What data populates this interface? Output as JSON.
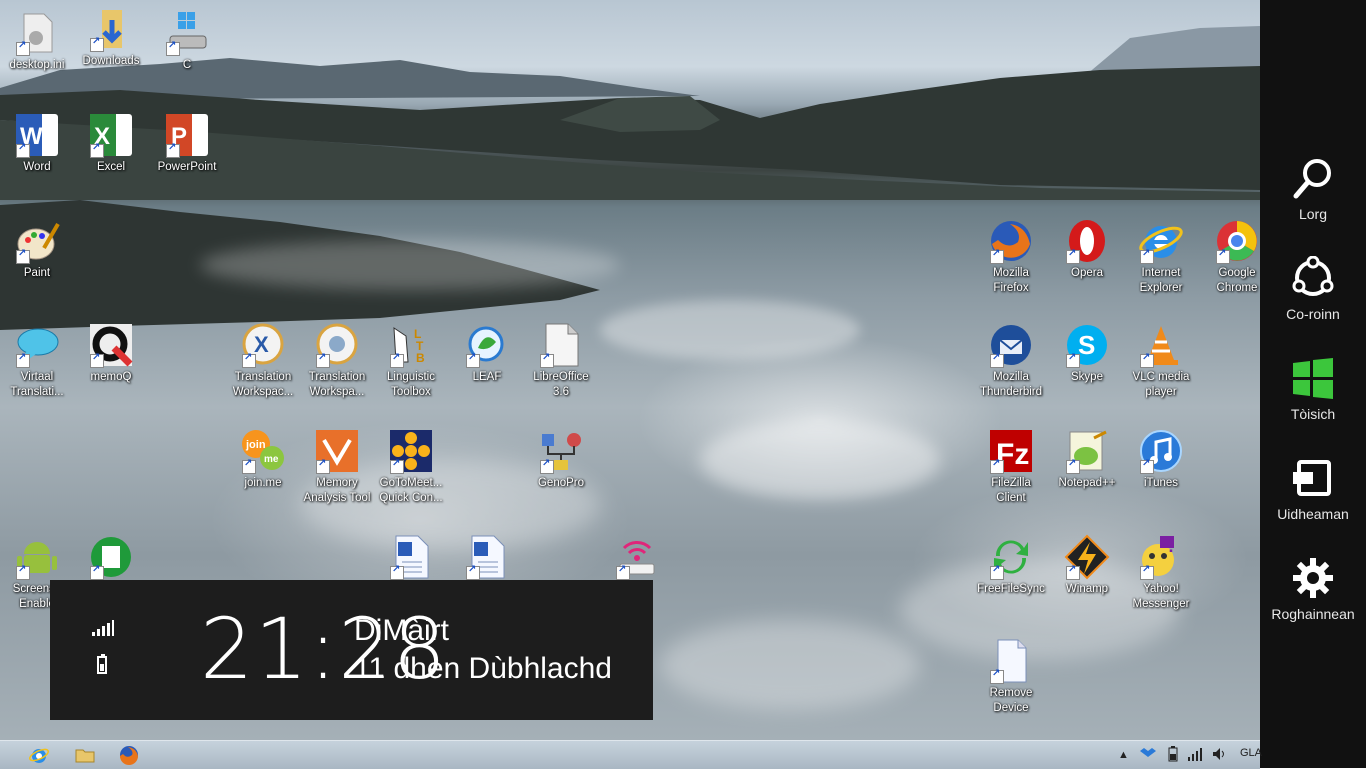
{
  "desktop": {
    "icons": [
      {
        "label": "desktop.ini",
        "icon": "settings-file-icon"
      },
      {
        "label": "Downloads",
        "icon": "download-folder-icon"
      },
      {
        "label": "C",
        "icon": "drive-icon"
      },
      {
        "label": "Word",
        "icon": "word-icon"
      },
      {
        "label": "Excel",
        "icon": "excel-icon"
      },
      {
        "label": "PowerPoint",
        "icon": "powerpoint-icon"
      },
      {
        "label": "Paint",
        "icon": "paint-icon"
      },
      {
        "label": "Virtaal\nTranslati...",
        "icon": "virtaal-icon"
      },
      {
        "label": "memoQ",
        "icon": "memoq-icon"
      },
      {
        "label": "Translation\nWorkspac...",
        "icon": "translation-workspace-icon"
      },
      {
        "label": "Translation\nWorkspa...",
        "icon": "translation-workspace-2-icon"
      },
      {
        "label": "Linguistic\nToolbox",
        "icon": "linguistic-toolbox-icon"
      },
      {
        "label": "LEAF",
        "icon": "leaf-icon"
      },
      {
        "label": "LibreOffice\n3.6",
        "icon": "libreoffice-icon"
      },
      {
        "label": "join.me",
        "icon": "joinme-icon"
      },
      {
        "label": "Memory\nAnalysis Tool",
        "icon": "memory-analysis-icon"
      },
      {
        "label": "GoToMeet...\nQuick Con...",
        "icon": "gotomeeting-icon"
      },
      {
        "label": "GenoPro",
        "icon": "genopro-icon"
      },
      {
        "label": "Screensh\nEnable",
        "icon": "android-icon"
      },
      {
        "label": "",
        "icon": "green-app-icon"
      },
      {
        "label": "",
        "icon": "word-doc-icon"
      },
      {
        "label": "",
        "icon": "word-doc-2-icon"
      },
      {
        "label": "",
        "icon": "wifi-device-icon"
      },
      {
        "label": "Mozilla\nFirefox",
        "icon": "firefox-icon"
      },
      {
        "label": "Opera",
        "icon": "opera-icon"
      },
      {
        "label": "Internet\nExplorer",
        "icon": "ie-icon"
      },
      {
        "label": "Google\nChrome",
        "icon": "chrome-icon"
      },
      {
        "label": "Mozilla\nThunderbird",
        "icon": "thunderbird-icon"
      },
      {
        "label": "Skype",
        "icon": "skype-icon"
      },
      {
        "label": "VLC media\nplayer",
        "icon": "vlc-icon"
      },
      {
        "label": "FileZilla\nClient",
        "icon": "filezilla-icon"
      },
      {
        "label": "Notepad++",
        "icon": "notepadpp-icon"
      },
      {
        "label": "iTunes",
        "icon": "itunes-icon"
      },
      {
        "label": "FreeFileSync",
        "icon": "freefilesync-icon"
      },
      {
        "label": "Winamp",
        "icon": "winamp-icon"
      },
      {
        "label": "Yahoo!\nMessenger",
        "icon": "yahoo-messenger-icon"
      },
      {
        "label": "Remove\nDevice",
        "icon": "remove-device-icon"
      }
    ]
  },
  "clock": {
    "time": "21:28",
    "day": "DiMàirt",
    "date": "11 dhen Dùbhlachd"
  },
  "charms": {
    "search": "Lorg",
    "share": "Co-roinn",
    "start": "Tòisich",
    "devices": "Uidheaman",
    "settings": "Roghainnean"
  },
  "taskbar": {
    "language": "GLA"
  },
  "colors": {
    "charms_bg": "#111111",
    "clock_bg": "#1d1d1d",
    "windows_green": "#3cc63c"
  }
}
